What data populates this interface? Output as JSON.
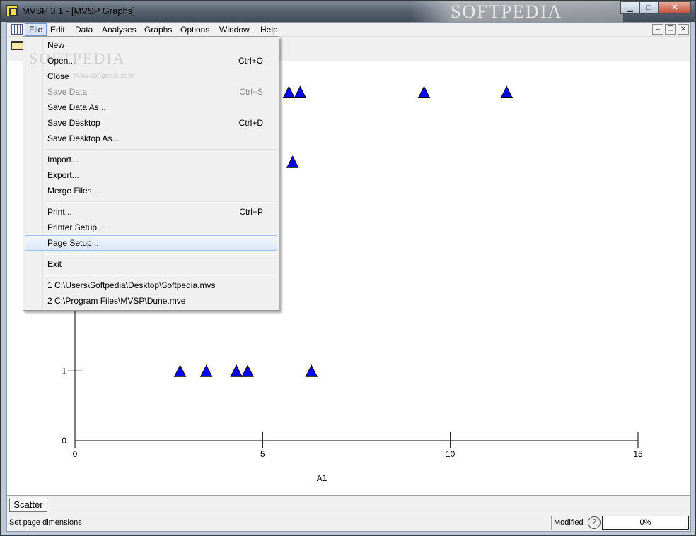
{
  "window": {
    "title": "MVSP 3.1 - [MVSP Graphs]",
    "watermark": "SOFTPEDIA",
    "minimize": "▁",
    "maximize": "□",
    "close": "✕"
  },
  "menubar": {
    "items": [
      "File",
      "Edit",
      "Data",
      "Analyses",
      "Graphs",
      "Options",
      "Window",
      "Help"
    ],
    "mdi_min": "–",
    "mdi_restore": "❐",
    "mdi_close": "✕"
  },
  "file_menu": {
    "watermark": "SOFTPEDIA",
    "watermark_url": "www.softpedia.com",
    "items": [
      {
        "label": "New",
        "shortcut": ""
      },
      {
        "label": "Open...",
        "shortcut": "Ctrl+O"
      },
      {
        "label": "Close",
        "shortcut": ""
      },
      {
        "label": "Save Data",
        "shortcut": "Ctrl+S",
        "disabled": true
      },
      {
        "label": "Save Data As...",
        "shortcut": ""
      },
      {
        "label": "Save Desktop",
        "shortcut": "Ctrl+D"
      },
      {
        "label": "Save Desktop As...",
        "shortcut": ""
      },
      {
        "label": "Import...",
        "shortcut": ""
      },
      {
        "label": "Export...",
        "shortcut": ""
      },
      {
        "label": "Merge Files...",
        "shortcut": ""
      },
      {
        "label": "Print...",
        "shortcut": "Ctrl+P"
      },
      {
        "label": "Printer Setup...",
        "shortcut": ""
      },
      {
        "label": "Page Setup...",
        "shortcut": "",
        "highlighted": true
      },
      {
        "label": "Exit",
        "shortcut": ""
      },
      {
        "label": "1 C:\\Users\\Softpedia\\Desktop\\Softpedia.mvs",
        "shortcut": ""
      },
      {
        "label": "2 C:\\Program Files\\MVSP\\Dune.mve",
        "shortcut": ""
      }
    ]
  },
  "chart_data": {
    "type": "scatter",
    "title": "",
    "xlabel": "A1",
    "ylabel": "",
    "xlim": [
      0,
      15
    ],
    "ylim": [
      0,
      5
    ],
    "x_ticks": [
      "0",
      "5",
      "10",
      "15"
    ],
    "y_ticks": [
      "0",
      "1"
    ],
    "marker": "triangle",
    "marker_color": "#0000ff",
    "points": [
      {
        "x": 2.8,
        "y": 1
      },
      {
        "x": 3.5,
        "y": 1
      },
      {
        "x": 4.3,
        "y": 1
      },
      {
        "x": 4.6,
        "y": 1
      },
      {
        "x": 6.3,
        "y": 1
      },
      {
        "x": 5.8,
        "y": 4
      },
      {
        "x": 5.7,
        "y": 5
      },
      {
        "x": 6.0,
        "y": 5
      },
      {
        "x": 9.3,
        "y": 5
      },
      {
        "x": 11.5,
        "y": 5
      }
    ]
  },
  "tabs": [
    "Scatter"
  ],
  "status": {
    "message": "Set page dimensions",
    "modified": "Modified",
    "progress_label": "0%",
    "progress_value": 0
  }
}
